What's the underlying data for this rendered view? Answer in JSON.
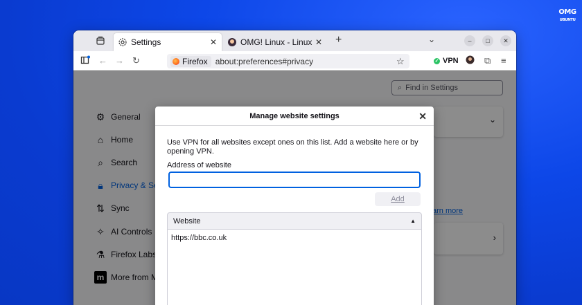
{
  "brand": {
    "logo_text": "OMG UBUNTU"
  },
  "tabs": [
    {
      "title": "Settings",
      "active": true
    },
    {
      "title": "OMG! Linux - Linux News,",
      "active": false
    }
  ],
  "url": {
    "identity": "Firefox",
    "address": "about:preferences#privacy"
  },
  "vpn": {
    "label": "VPN",
    "status_color": "#2ac364"
  },
  "search": {
    "placeholder": "Find in Settings"
  },
  "sidebar": {
    "items": [
      {
        "label": "General",
        "icon": "gear-icon"
      },
      {
        "label": "Home",
        "icon": "home-icon"
      },
      {
        "label": "Search",
        "icon": "search-icon"
      },
      {
        "label": "Privacy & Sec",
        "icon": "lock-icon",
        "active": true
      },
      {
        "label": "Sync",
        "icon": "sync-icon"
      },
      {
        "label": "AI Controls",
        "icon": "sparkle-icon"
      },
      {
        "label": "Firefox Labs",
        "icon": "flask-icon"
      },
      {
        "label": "More from M",
        "icon": "mozilla-icon"
      }
    ]
  },
  "background_link": "arn more",
  "dialog": {
    "title": "Manage website settings",
    "description": "Use VPN for all websites except ones on this list. Add a website here or by opening VPN.",
    "address_label": "Address of website",
    "address_value": "",
    "add_label": "Add",
    "table": {
      "column": "Website",
      "rows": [
        "https://bbc.co.uk"
      ]
    }
  },
  "colors": {
    "accent": "#0061e0",
    "desktop": "#0d47e8"
  }
}
